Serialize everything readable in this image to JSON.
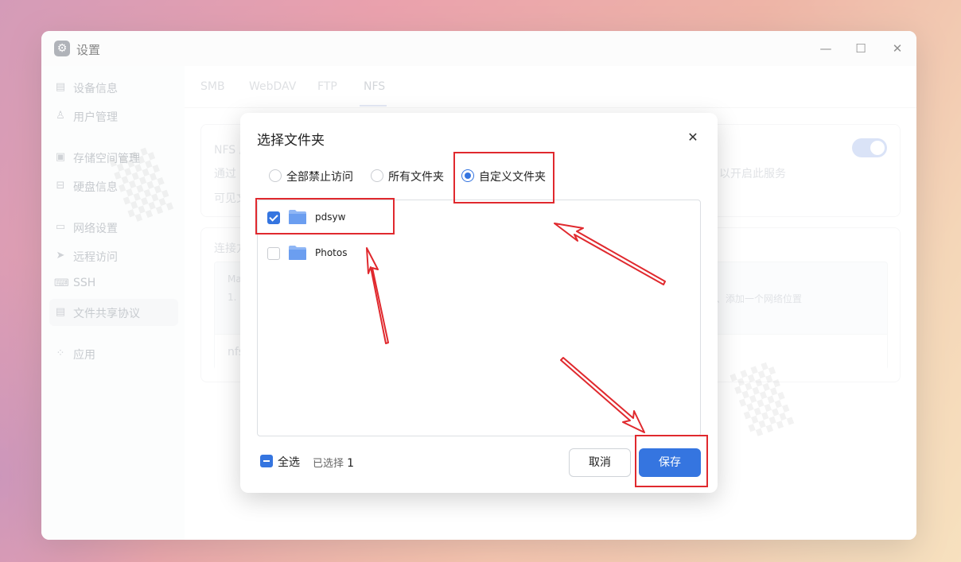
{
  "window": {
    "title": "设置",
    "icon": "gear-icon",
    "controls": [
      "minimize",
      "maximize",
      "close"
    ]
  },
  "sidebar": {
    "items": [
      {
        "label": "设备信息",
        "icon": "device-icon",
        "active": false
      },
      {
        "label": "用户管理",
        "icon": "user-icon",
        "active": false
      },
      {
        "label": "存储空间管理",
        "icon": "storage-icon",
        "active": false
      },
      {
        "label": "硬盘信息",
        "icon": "disk-icon",
        "active": false
      },
      {
        "label": "网络设置",
        "icon": "network-icon",
        "active": false
      },
      {
        "label": "远程访问",
        "icon": "remote-icon",
        "active": false
      },
      {
        "label": "SSH",
        "icon": "code-icon",
        "active": false
      },
      {
        "label": "文件共享协议",
        "icon": "document-icon",
        "active": true
      },
      {
        "label": "应用",
        "icon": "apps-icon",
        "active": false
      }
    ]
  },
  "tabs": [
    {
      "label": "SMB"
    },
    {
      "label": "WebDAV"
    },
    {
      "label": "FTP"
    },
    {
      "label": "NFS",
      "active": true
    }
  ],
  "background_content": {
    "card1_title": "NFS 服",
    "card1_line1_start": "通过",
    "card1_line1_end": "以开启此服务",
    "card1_line2": "可见文",
    "card2_title": "连接方",
    "card2_tab": "Ma",
    "card2_step": "1.",
    "card2_step_end": "、添加一个网络位置",
    "card2_footer": "nfs"
  },
  "dialog": {
    "title": "选择文件夹",
    "radio_options": [
      {
        "label": "全部禁止访问",
        "selected": false
      },
      {
        "label": "所有文件夹",
        "selected": false
      },
      {
        "label": "自定义文件夹",
        "selected": true
      }
    ],
    "folders": [
      {
        "name": "pdsyw",
        "checked": true
      },
      {
        "name": "Photos",
        "checked": false
      }
    ],
    "select_all_label": "全选",
    "selected_prefix": "已选择",
    "selected_count": "1",
    "cancel_label": "取消",
    "save_label": "保存"
  },
  "colors": {
    "accent": "#3575e0",
    "annotation_red": "#e0292e",
    "folder_blue": "#6b9ef0"
  }
}
